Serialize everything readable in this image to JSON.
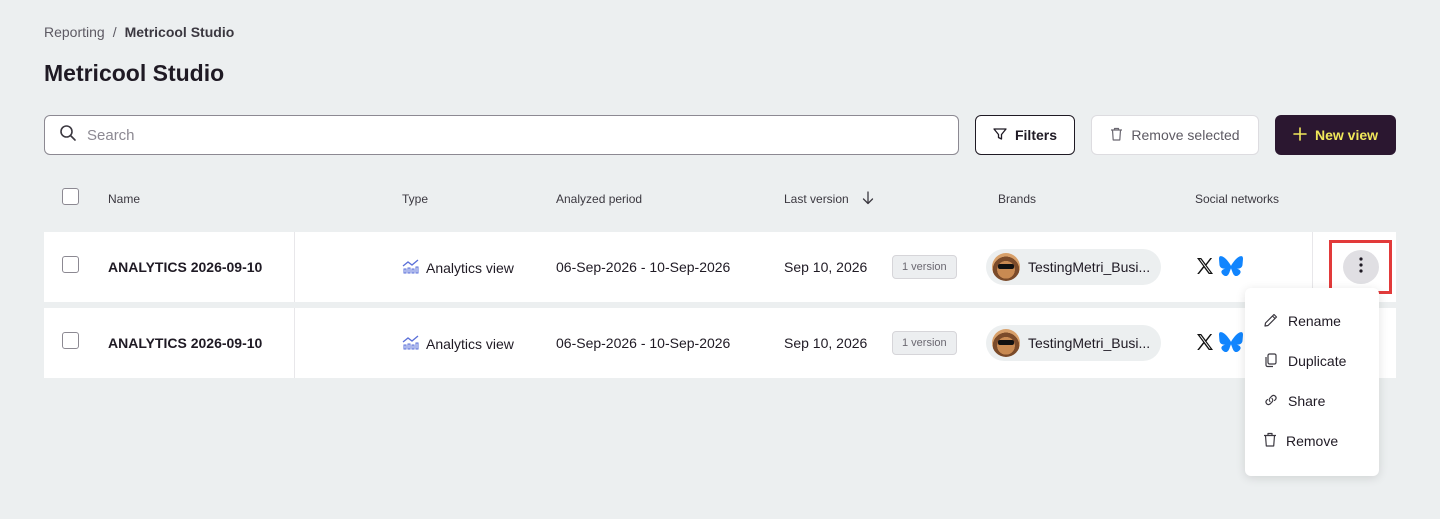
{
  "breadcrumb": {
    "parent": "Reporting",
    "separator": "/",
    "current": "Metricool Studio"
  },
  "page_title": "Metricool Studio",
  "search": {
    "placeholder": "Search",
    "value": ""
  },
  "toolbar": {
    "filters_label": "Filters",
    "remove_selected_label": "Remove selected",
    "new_view_label": "New view"
  },
  "table": {
    "columns": {
      "name": "Name",
      "type": "Type",
      "analyzed_period": "Analyzed period",
      "last_version": "Last version",
      "brands": "Brands",
      "social_networks": "Social networks"
    },
    "rows": [
      {
        "name": "ANALYTICS 2026-09-10",
        "type": "Analytics view",
        "period": "06-Sep-2026 - 10-Sep-2026",
        "last_version": "Sep 10, 2026",
        "versions": "1 version",
        "brand": "TestingMetri_Busi...",
        "socials": [
          "x-icon",
          "bluesky-icon"
        ]
      },
      {
        "name": "ANALYTICS 2026-09-10",
        "type": "Analytics view",
        "period": "06-Sep-2026 - 10-Sep-2026",
        "last_version": "Sep 10, 2026",
        "versions": "1 version",
        "brand": "TestingMetri_Busi...",
        "socials": [
          "x-icon",
          "bluesky-icon"
        ]
      }
    ]
  },
  "context_menu": {
    "items": [
      {
        "label": "Rename",
        "icon": "pencil-icon"
      },
      {
        "label": "Duplicate",
        "icon": "copy-icon"
      },
      {
        "label": "Share",
        "icon": "link-icon"
      },
      {
        "label": "Remove",
        "icon": "trash-icon"
      }
    ]
  },
  "colors": {
    "background": "#eceff0",
    "primary_button": "#2b1730",
    "primary_button_text": "#f1e85a",
    "highlight_frame": "#e23a3a",
    "bluesky": "#1185fe"
  }
}
